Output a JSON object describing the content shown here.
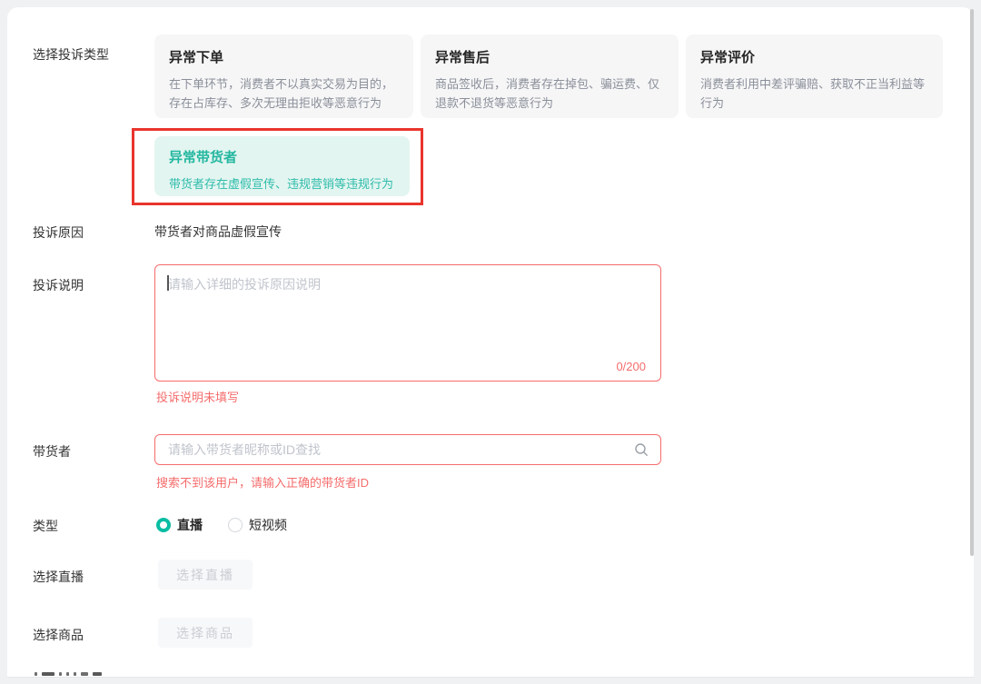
{
  "form": {
    "rows": {
      "complaint_type": {
        "label": "选择投诉类型",
        "cards": [
          {
            "title": "异常下单",
            "desc": "在下单环节，消费者不以真实交易为目的，存在占库存、多次无理由拒收等恶意行为",
            "selected": false
          },
          {
            "title": "异常售后",
            "desc": "商品签收后，消费者存在掉包、骗运费、仅退款不退货等恶意行为",
            "selected": false
          },
          {
            "title": "异常评价",
            "desc": "消费者利用中差评骗赔、获取不正当利益等行为",
            "selected": false
          },
          {
            "title": "异常带货者",
            "desc": "带货者存在虚假宣传、违规营销等违规行为",
            "selected": true
          }
        ]
      },
      "complaint_reason": {
        "label": "投诉原因",
        "value": "带货者对商品虚假宣传"
      },
      "complaint_desc": {
        "label": "投诉说明",
        "placeholder": "请输入详细的投诉原因说明",
        "value": "",
        "counter": "0/200",
        "error": "投诉说明未填写"
      },
      "promoter": {
        "label": "带货者",
        "placeholder": "请输入带货者昵称或ID查找",
        "value": "",
        "error": "搜索不到该用户，请输入正确的带货者ID"
      },
      "type": {
        "label": "类型",
        "options": [
          {
            "label": "直播",
            "selected": true
          },
          {
            "label": "短视频",
            "selected": false
          }
        ]
      },
      "select_live": {
        "label": "选择直播",
        "button": "选择直播",
        "disabled": true
      },
      "select_product": {
        "label": "选择商品",
        "button": "选择商品",
        "disabled": true
      }
    },
    "colors": {
      "accent_teal": "#0abda3",
      "selected_card_bg": "#e3f5f0",
      "selected_card_text": "#22b7a0",
      "annotation_red": "#e9352d",
      "error_red": "#f56c6c",
      "card_bg": "#f6f6f7",
      "panel_bg": "#ffffff",
      "page_bg": "#f0f1f2"
    }
  }
}
